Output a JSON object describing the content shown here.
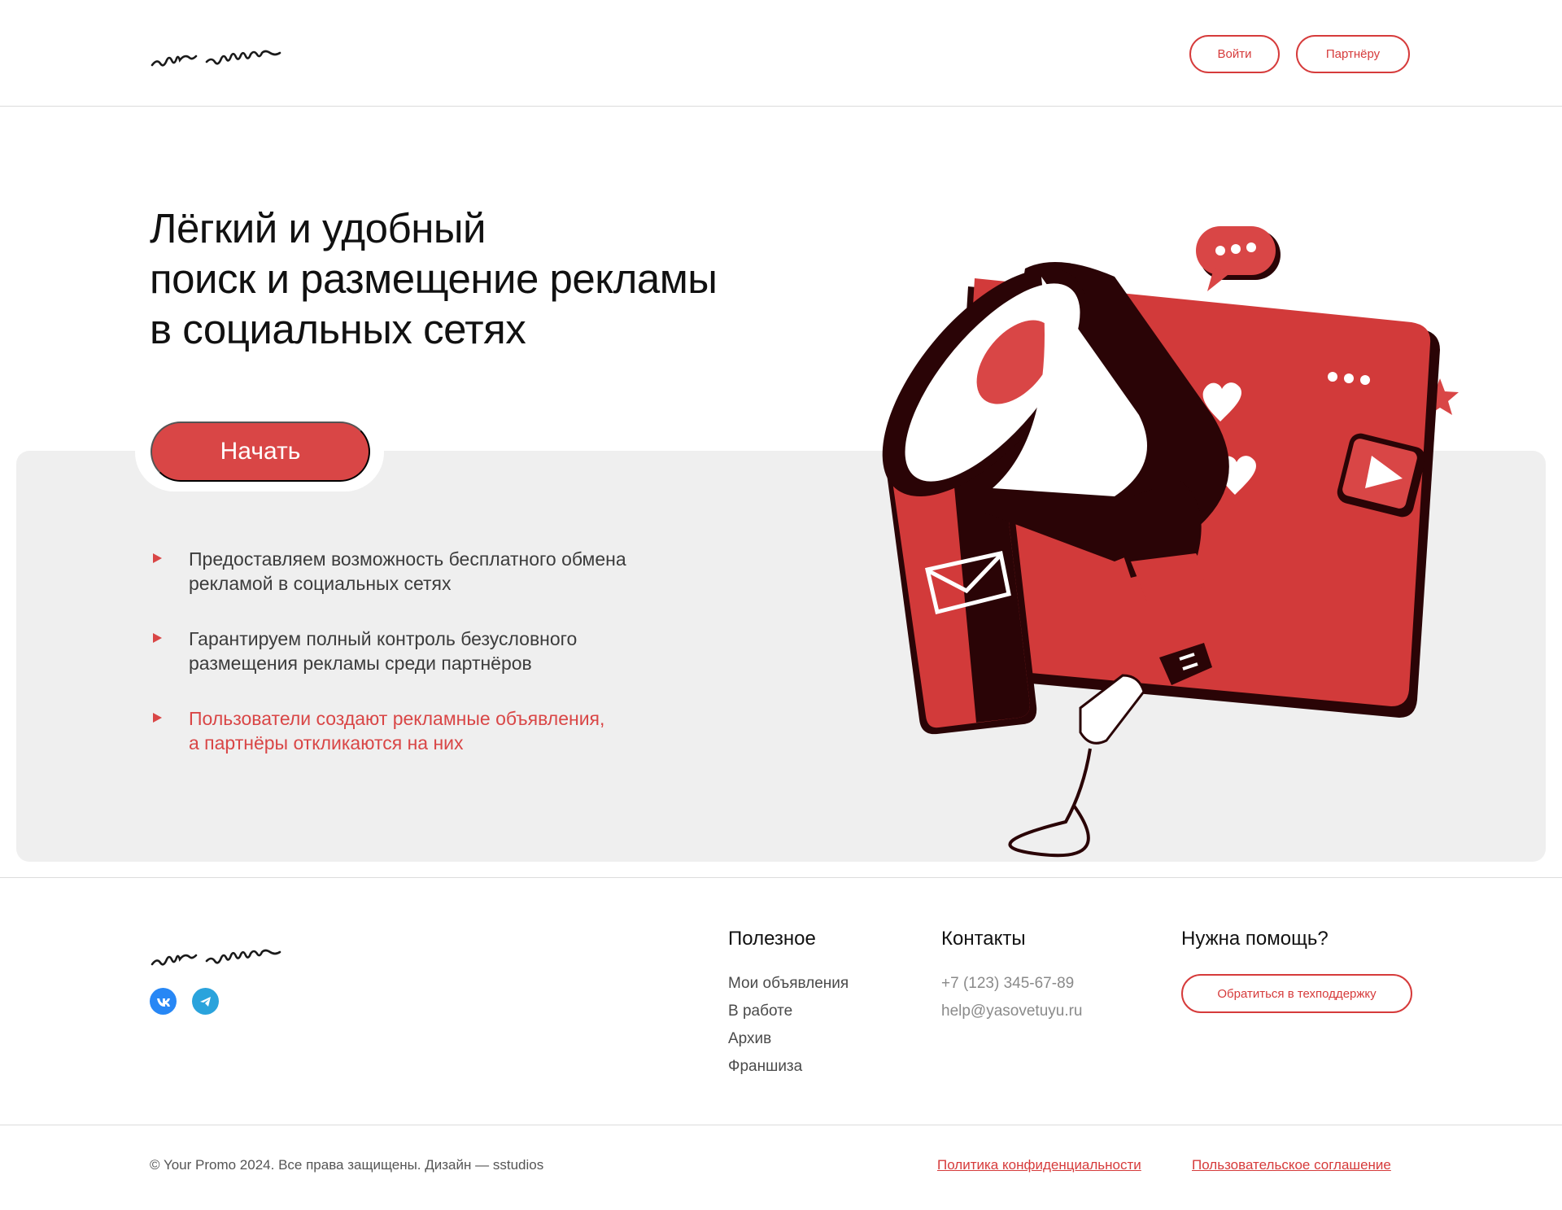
{
  "header": {
    "login_label": "Войти",
    "partner_label": "Партнёру"
  },
  "hero": {
    "title_lines": [
      "Лёгкий и удобный",
      "поиск и размещение рекламы",
      "в социальных сетях"
    ],
    "start_label": "Начать",
    "features": [
      {
        "lines": [
          "Предоставляем возможность бесплатного обмена",
          "рекламой в социальных сетях"
        ]
      },
      {
        "lines": [
          "Гарантируем полный контроль безусловного",
          "размещения рекламы среди партнёров"
        ]
      },
      {
        "lines": [
          "Пользователи создают рекламные объявления,",
          "а партнёры откликаются на них"
        ]
      }
    ]
  },
  "footer": {
    "useful": {
      "title": "Полезное",
      "links": [
        "Мои объявления",
        "В работе",
        "Архив",
        "Франшиза"
      ]
    },
    "contacts": {
      "title": "Контакты",
      "phone": "+7 (123) 345-67-89",
      "email": "help@yasovetuyu.ru"
    },
    "help": {
      "title": "Нужна помощь?",
      "button_label": "Обратиться в техподдержку"
    },
    "social": [
      "vk-icon",
      "telegram-icon"
    ],
    "copyright": "© Your Promo 2024. Все права защищены. Дизайн — sstudios",
    "privacy_label": "Политика конфиденциальности",
    "terms_label": "Пользовательское соглашение"
  },
  "colors": {
    "accent": "#d94646",
    "dark": "#2a0406",
    "panel": "#efefef"
  }
}
